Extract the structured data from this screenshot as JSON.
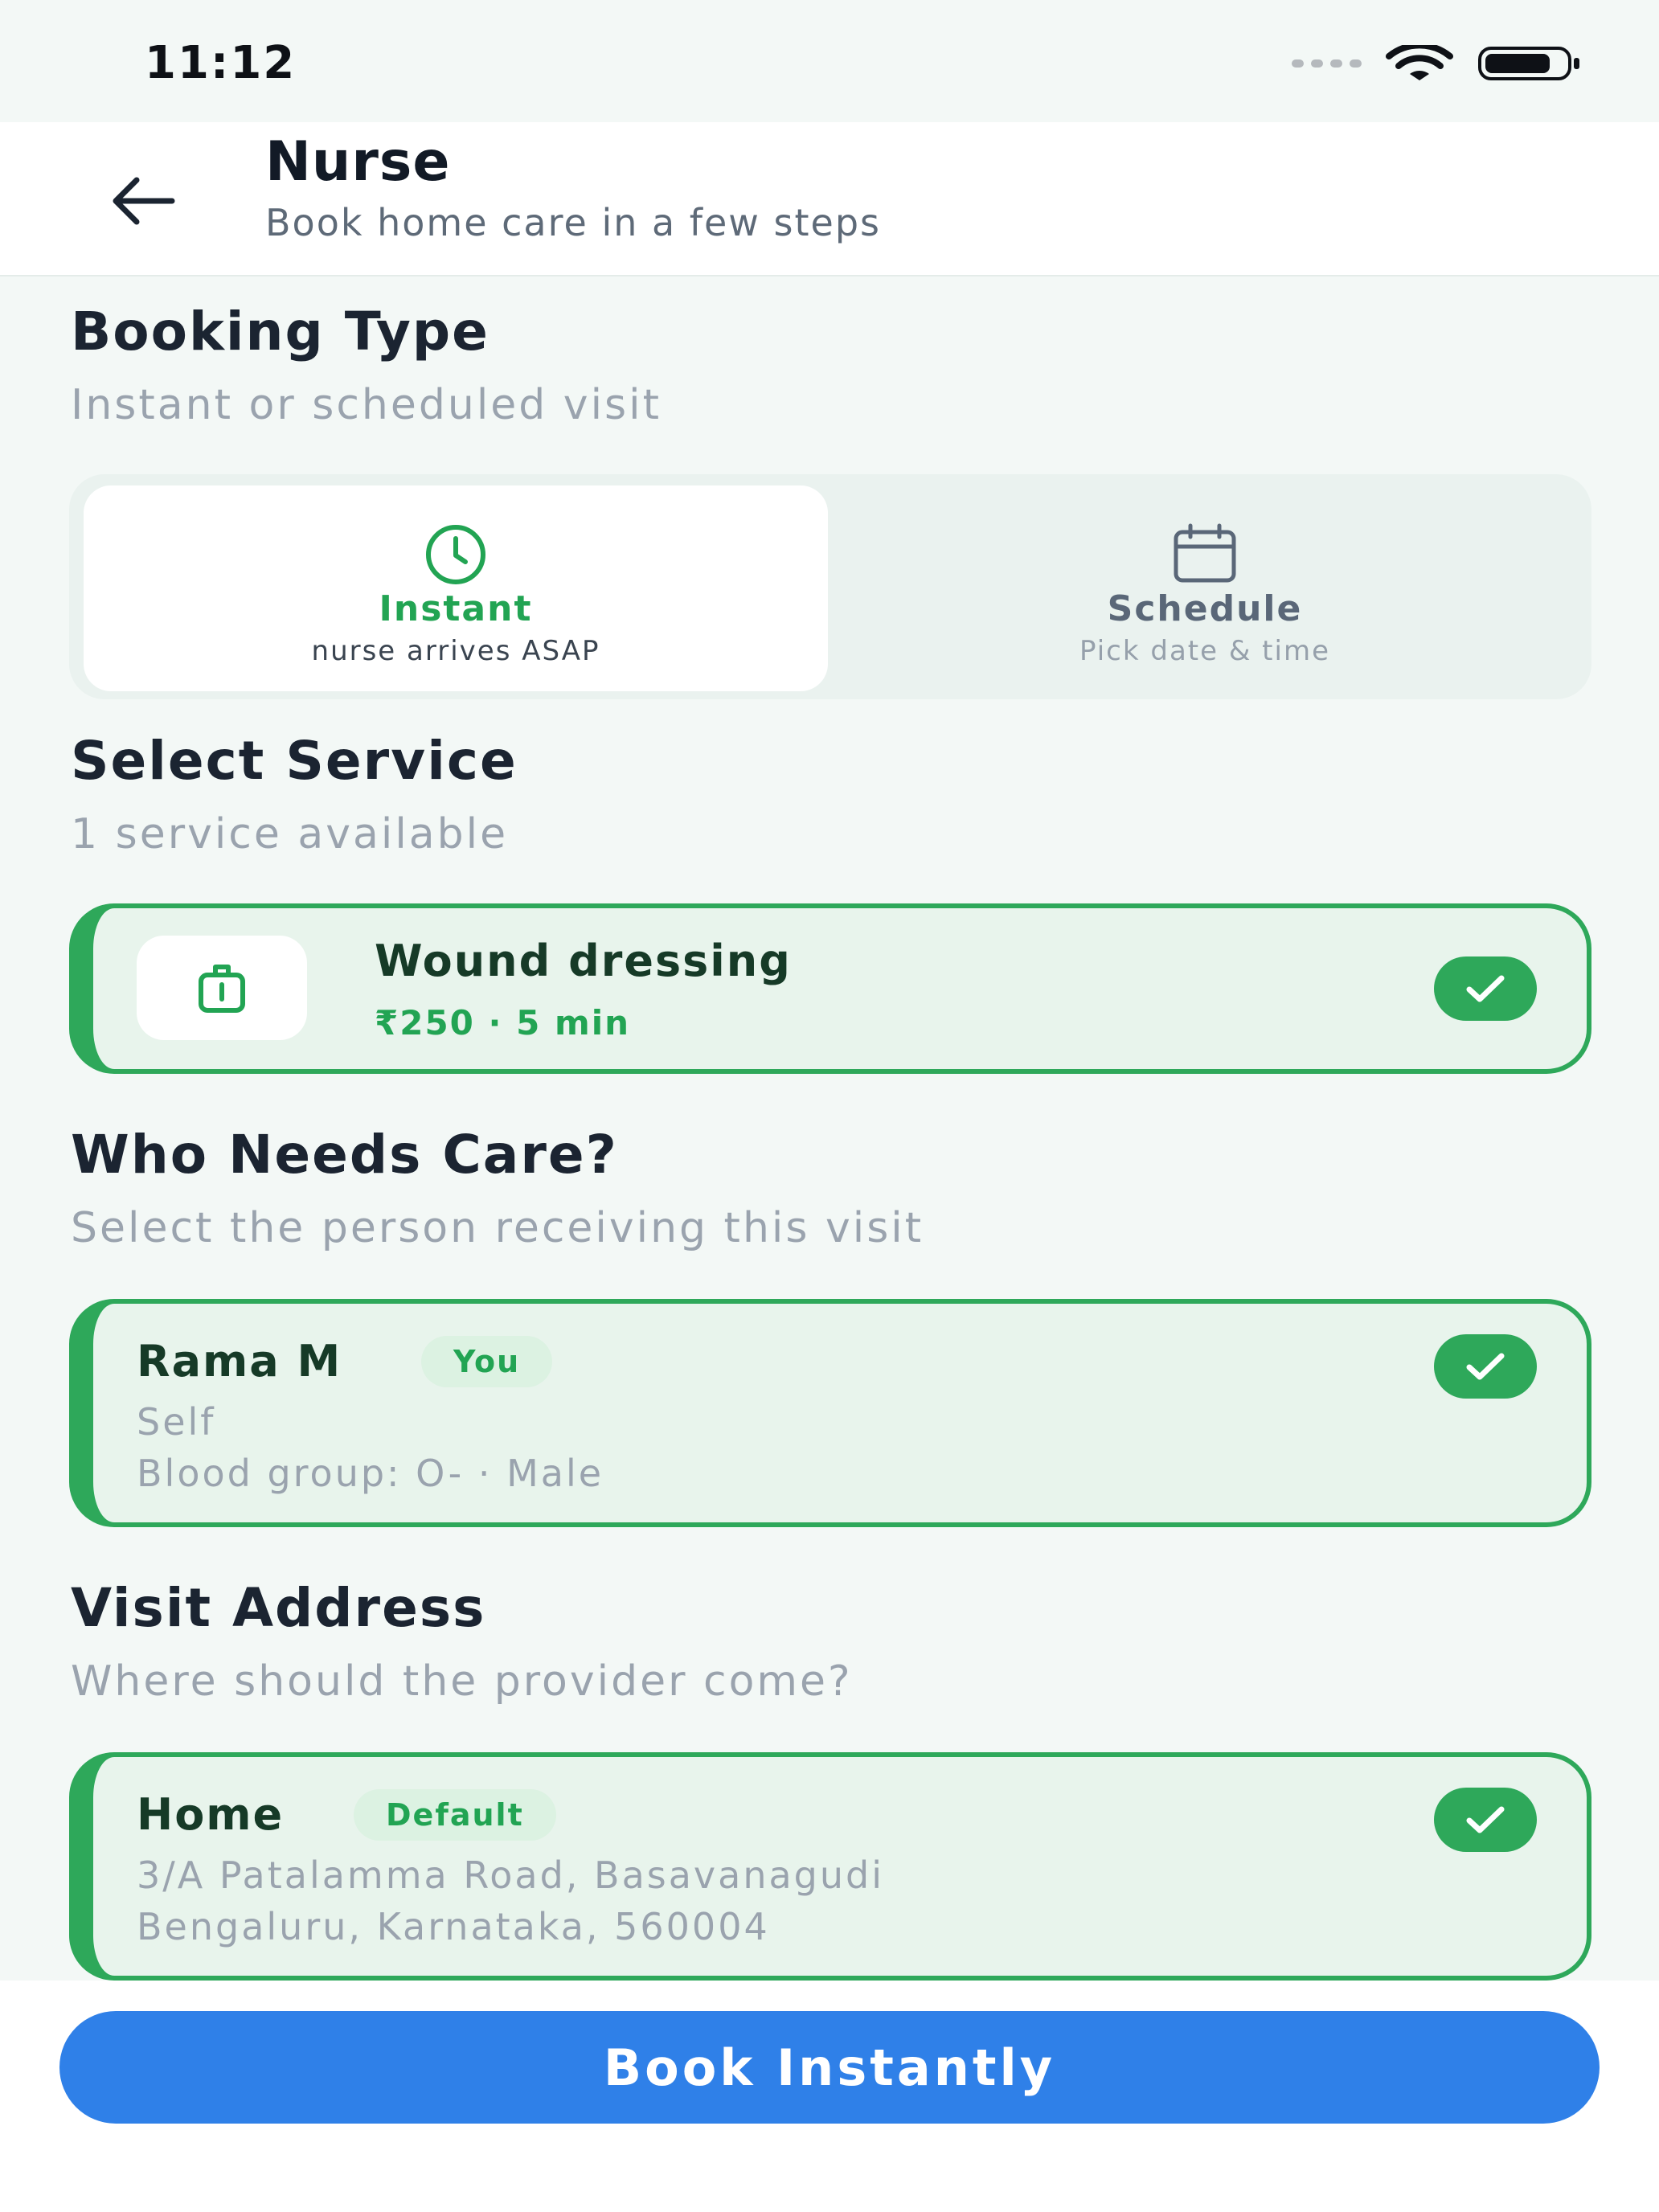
{
  "status_bar": {
    "time": "11:12"
  },
  "header": {
    "title": "Nurse",
    "subtitle": "Book home care in a few steps",
    "back_icon": "arrow-left-icon"
  },
  "booking_type": {
    "title": "Booking Type",
    "subtitle": "Instant or scheduled visit",
    "options": [
      {
        "label": "Instant",
        "note": "nurse arrives ASAP",
        "icon": "clock-icon",
        "selected": true
      },
      {
        "label": "Schedule",
        "note": "Pick date & time",
        "icon": "calendar-icon",
        "selected": false
      }
    ]
  },
  "service": {
    "title": "Select Service",
    "subtitle": "1 service available",
    "items": [
      {
        "name": "Wound dressing",
        "meta": "₹250 · 5 min",
        "icon": "medical-kit-icon",
        "selected": true
      }
    ]
  },
  "care_recipient": {
    "title": "Who Needs Care?",
    "subtitle": "Select the person receiving this visit",
    "people": [
      {
        "name": "Rama M",
        "badge": "You",
        "relation": "Self",
        "details": "Blood group: O- · Male",
        "selected": true
      }
    ]
  },
  "address": {
    "title": "Visit Address",
    "subtitle": "Where should the provider come?",
    "items": [
      {
        "label": "Home",
        "badge": "Default",
        "line1": "3/A Patalamma Road, Basavanagudi",
        "line2": "Bengaluru, Karnataka, 560004",
        "selected": true
      }
    ]
  },
  "cta": {
    "label": "Book Instantly",
    "color": "#2F80E8"
  },
  "colors": {
    "accent_green": "#2EA85A",
    "card_bg": "#E8F4EC",
    "page_bg": "#F3F8F6"
  }
}
